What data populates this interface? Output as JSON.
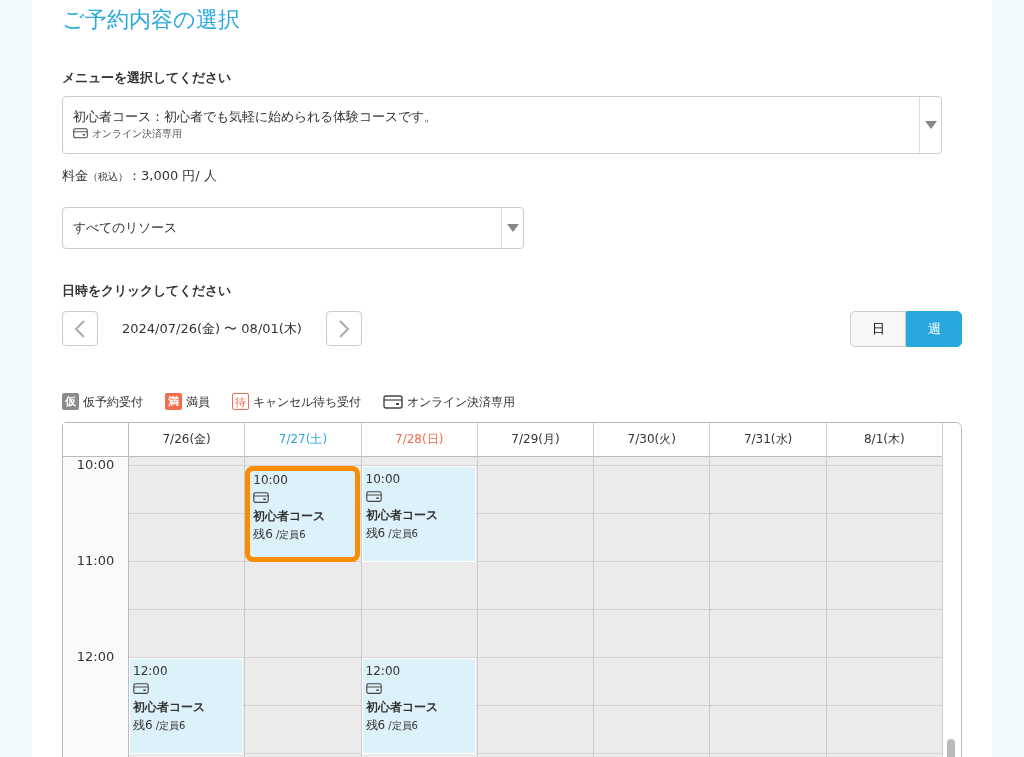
{
  "title": "ご予約内容の選択",
  "menu_label": "メニューを選択してください",
  "menu_select": {
    "value": "初心者コース：初心者でも気軽に始められる体験コースです。",
    "note": "オンライン決済専用"
  },
  "price": {
    "label": "料金",
    "tax": "（税込）",
    "value": "：3,000 円/ 人"
  },
  "resource_select": {
    "value": "すべてのリソース"
  },
  "date_label": "日時をクリックしてください",
  "date_range": "2024/07/26(金) 〜 08/01(木)",
  "view_toggle": [
    {
      "label": "日",
      "selected": false
    },
    {
      "label": "週",
      "selected": true
    }
  ],
  "legend": [
    {
      "kind": "badge",
      "badge": "仮",
      "label": "仮予約受付",
      "color": "#8c8c8c"
    },
    {
      "kind": "badge",
      "badge": "満",
      "label": "満員",
      "color": "#f26d4f"
    },
    {
      "kind": "outline",
      "badge": "待",
      "label": "キャンセル待ち受付",
      "color": "#f26d4f"
    },
    {
      "kind": "card",
      "label": "オンライン決済専用"
    }
  ],
  "calendar": {
    "hours": [
      "10:00",
      "11:00",
      "12:00"
    ],
    "days": [
      {
        "label": "7/26(金)",
        "color": "#333333",
        "events": [
          {
            "time": "12:00",
            "title": "初心者コース",
            "remaining": "残6",
            "capacity": "/定員6",
            "selected": false
          }
        ]
      },
      {
        "label": "7/27(土)",
        "color": "#29a8e0",
        "events": [
          {
            "time": "10:00",
            "title": "初心者コース",
            "remaining": "残6",
            "capacity": "/定員6",
            "selected": true
          }
        ]
      },
      {
        "label": "7/28(日)",
        "color": "#f26d4f",
        "events": [
          {
            "time": "10:00",
            "title": "初心者コース",
            "remaining": "残6",
            "capacity": "/定員6",
            "selected": false
          },
          {
            "time": "12:00",
            "title": "初心者コース",
            "remaining": "残6",
            "capacity": "/定員6",
            "selected": false
          }
        ]
      },
      {
        "label": "7/29(月)",
        "color": "#333333"
      },
      {
        "label": "7/30(火)",
        "color": "#333333"
      },
      {
        "label": "7/31(水)",
        "color": "#333333"
      },
      {
        "label": "8/1(木)",
        "color": "#333333"
      }
    ]
  }
}
